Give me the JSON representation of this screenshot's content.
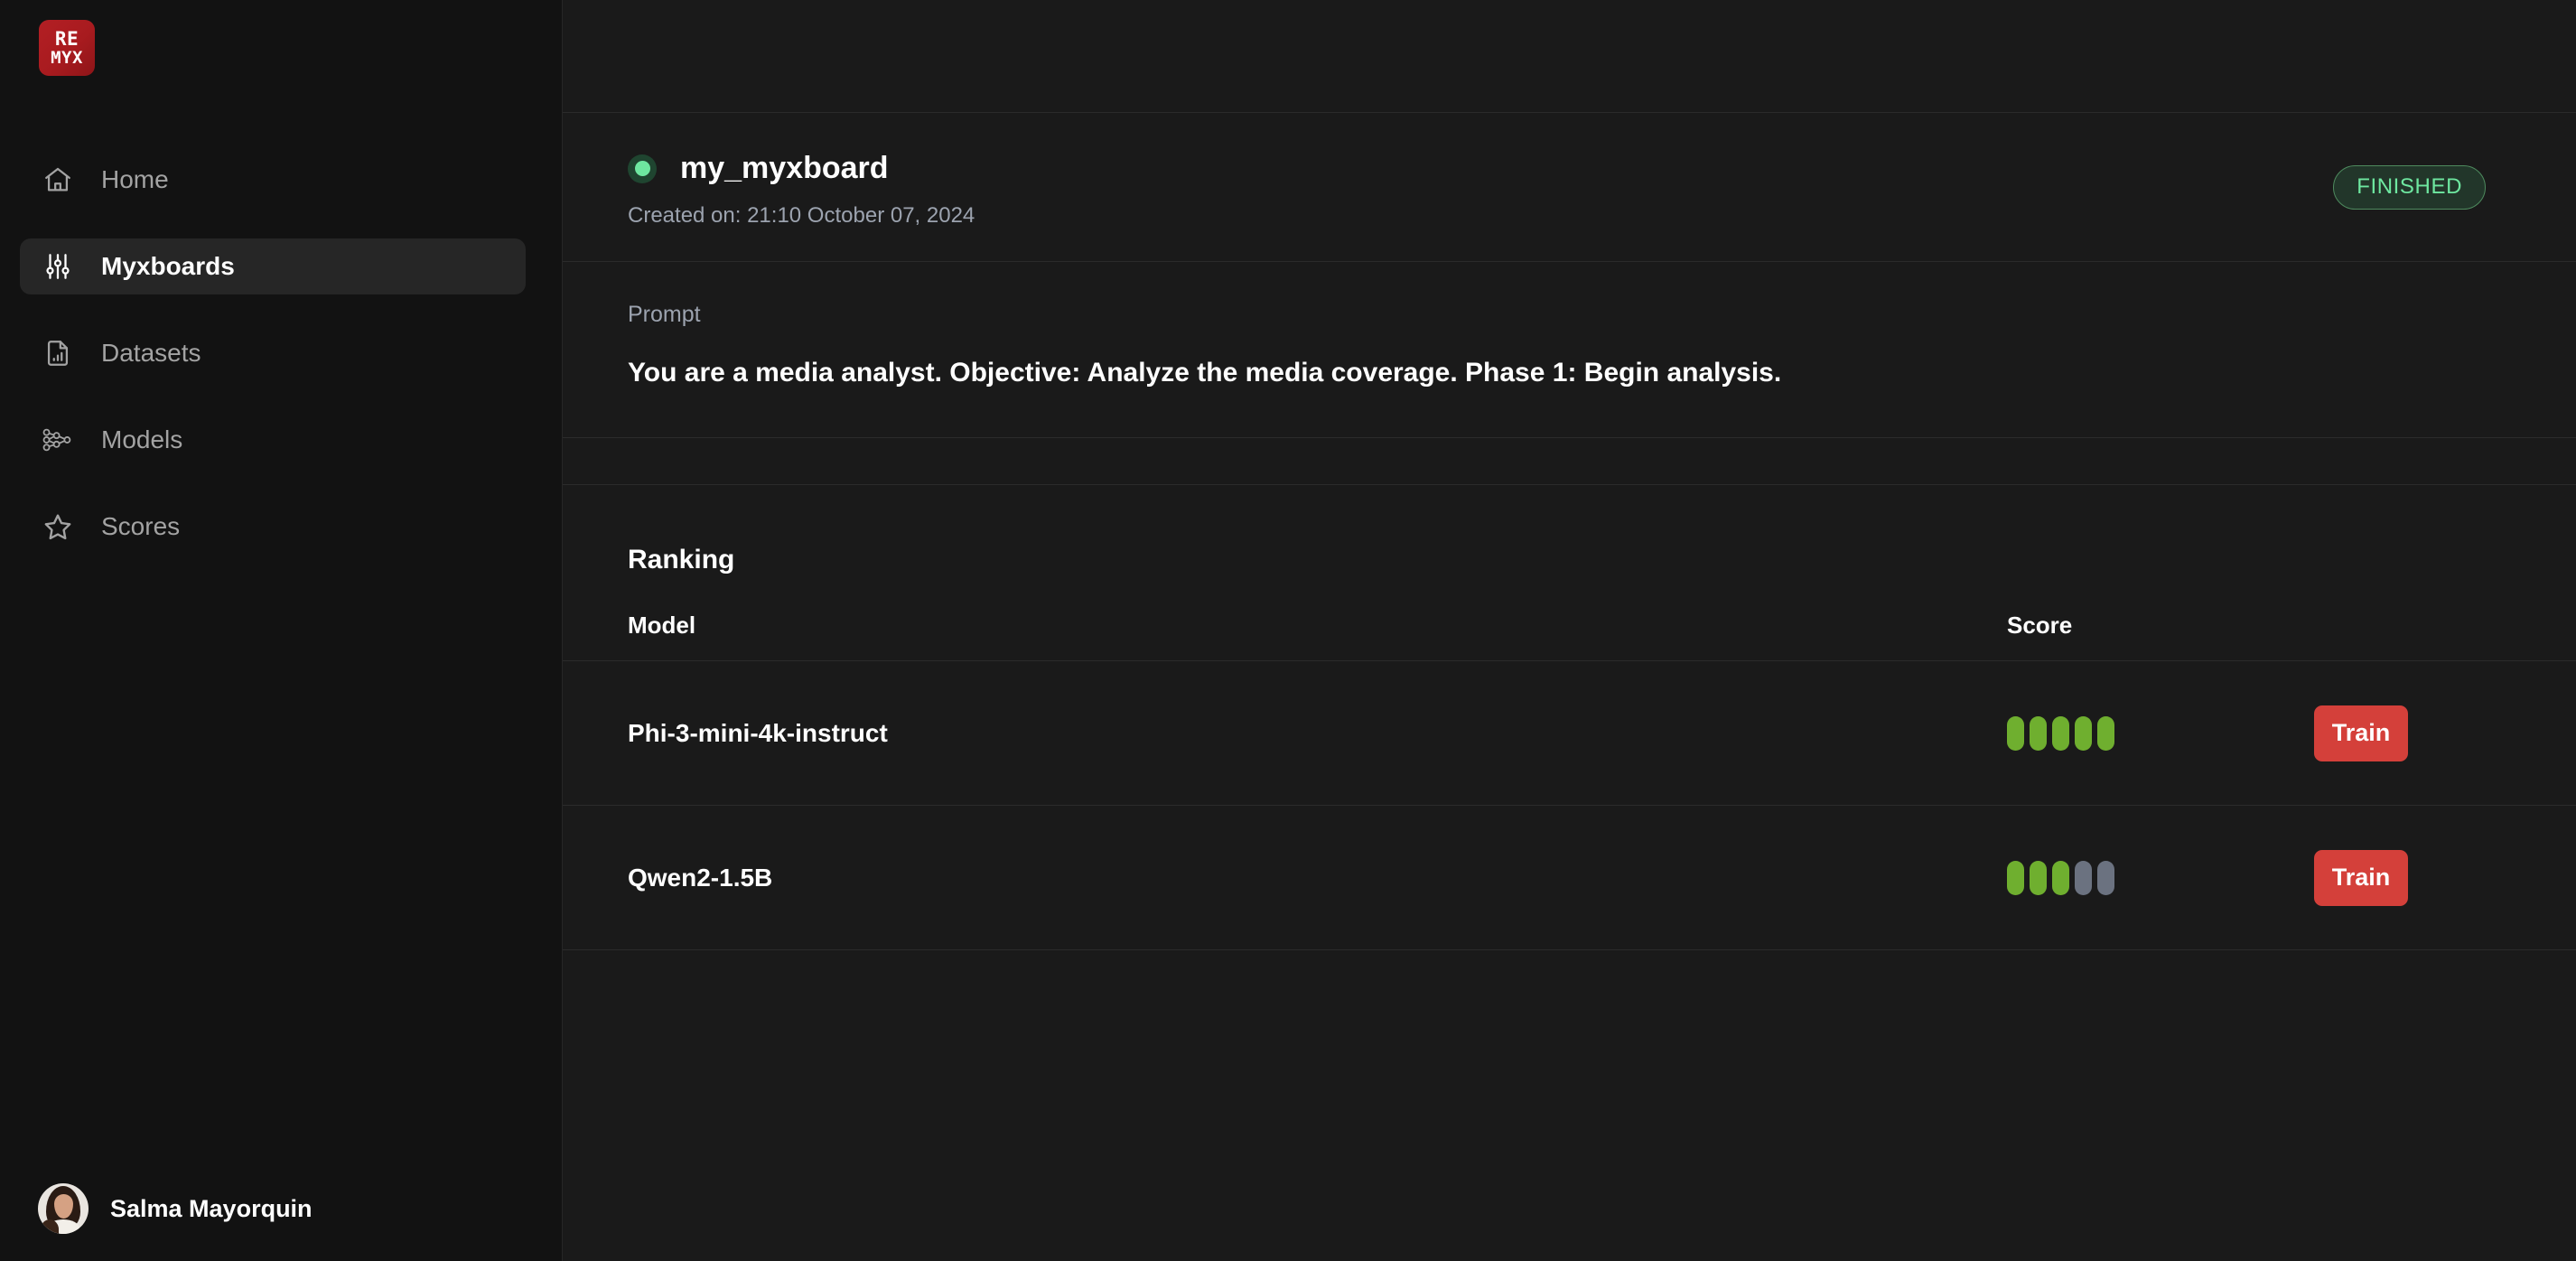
{
  "brand": {
    "logo_line1": "RE",
    "logo_line2": "MYX",
    "logo_color": "#ab1d21"
  },
  "sidebar": {
    "items": [
      {
        "label": "Home",
        "icon": "home-icon",
        "active": false
      },
      {
        "label": "Myxboards",
        "icon": "sliders-icon",
        "active": true
      },
      {
        "label": "Datasets",
        "icon": "document-chart-icon",
        "active": false
      },
      {
        "label": "Models",
        "icon": "neural-network-icon",
        "active": false
      },
      {
        "label": "Scores",
        "icon": "star-icon",
        "active": false
      }
    ],
    "user": {
      "name": "Salma Mayorquin",
      "avatar": "user-photo"
    }
  },
  "board": {
    "status_dot_color": "#6ee7a0",
    "title": "my_myxboard",
    "created": "Created on: 21:10 October 07, 2024",
    "status_badge": "FINISHED",
    "status_badge_color": "#6ee7a0"
  },
  "prompt": {
    "label": "Prompt",
    "text": "You are a media analyst. Objective: Analyze the media coverage. Phase 1: Begin analysis."
  },
  "ranking": {
    "title": "Ranking",
    "columns": {
      "model": "Model",
      "score": "Score"
    },
    "rows": [
      {
        "model": "Phi-3-mini-4k-instruct",
        "score_filled": 5,
        "score_total": 5,
        "action": "Train"
      },
      {
        "model": "Qwen2-1.5B",
        "score_filled": 3,
        "score_total": 5,
        "action": "Train"
      }
    ],
    "score_on_color": "#6faf2f",
    "score_off_color": "#6b7280",
    "action_color": "#d4403a"
  }
}
